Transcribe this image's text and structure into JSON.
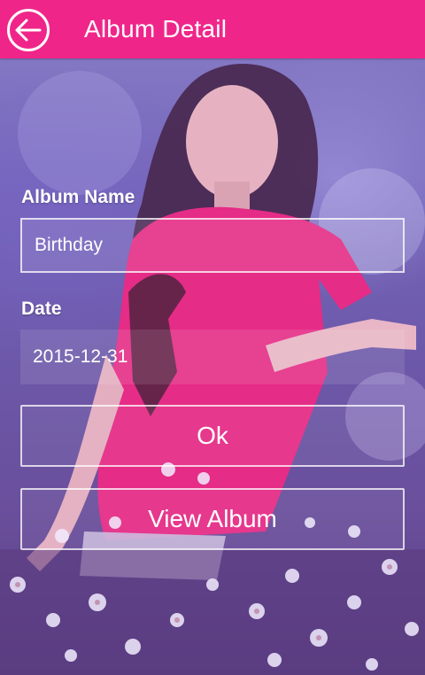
{
  "appbar": {
    "title": "Album Detail",
    "back_icon": "back-arrow-circle-icon",
    "color": "#f0258a"
  },
  "form": {
    "album_name_label": "Album Name",
    "album_name_value": "Birthday",
    "date_label": "Date",
    "date_value": "2015-12-31"
  },
  "buttons": {
    "ok_label": "Ok",
    "view_album_label": "View Album"
  }
}
